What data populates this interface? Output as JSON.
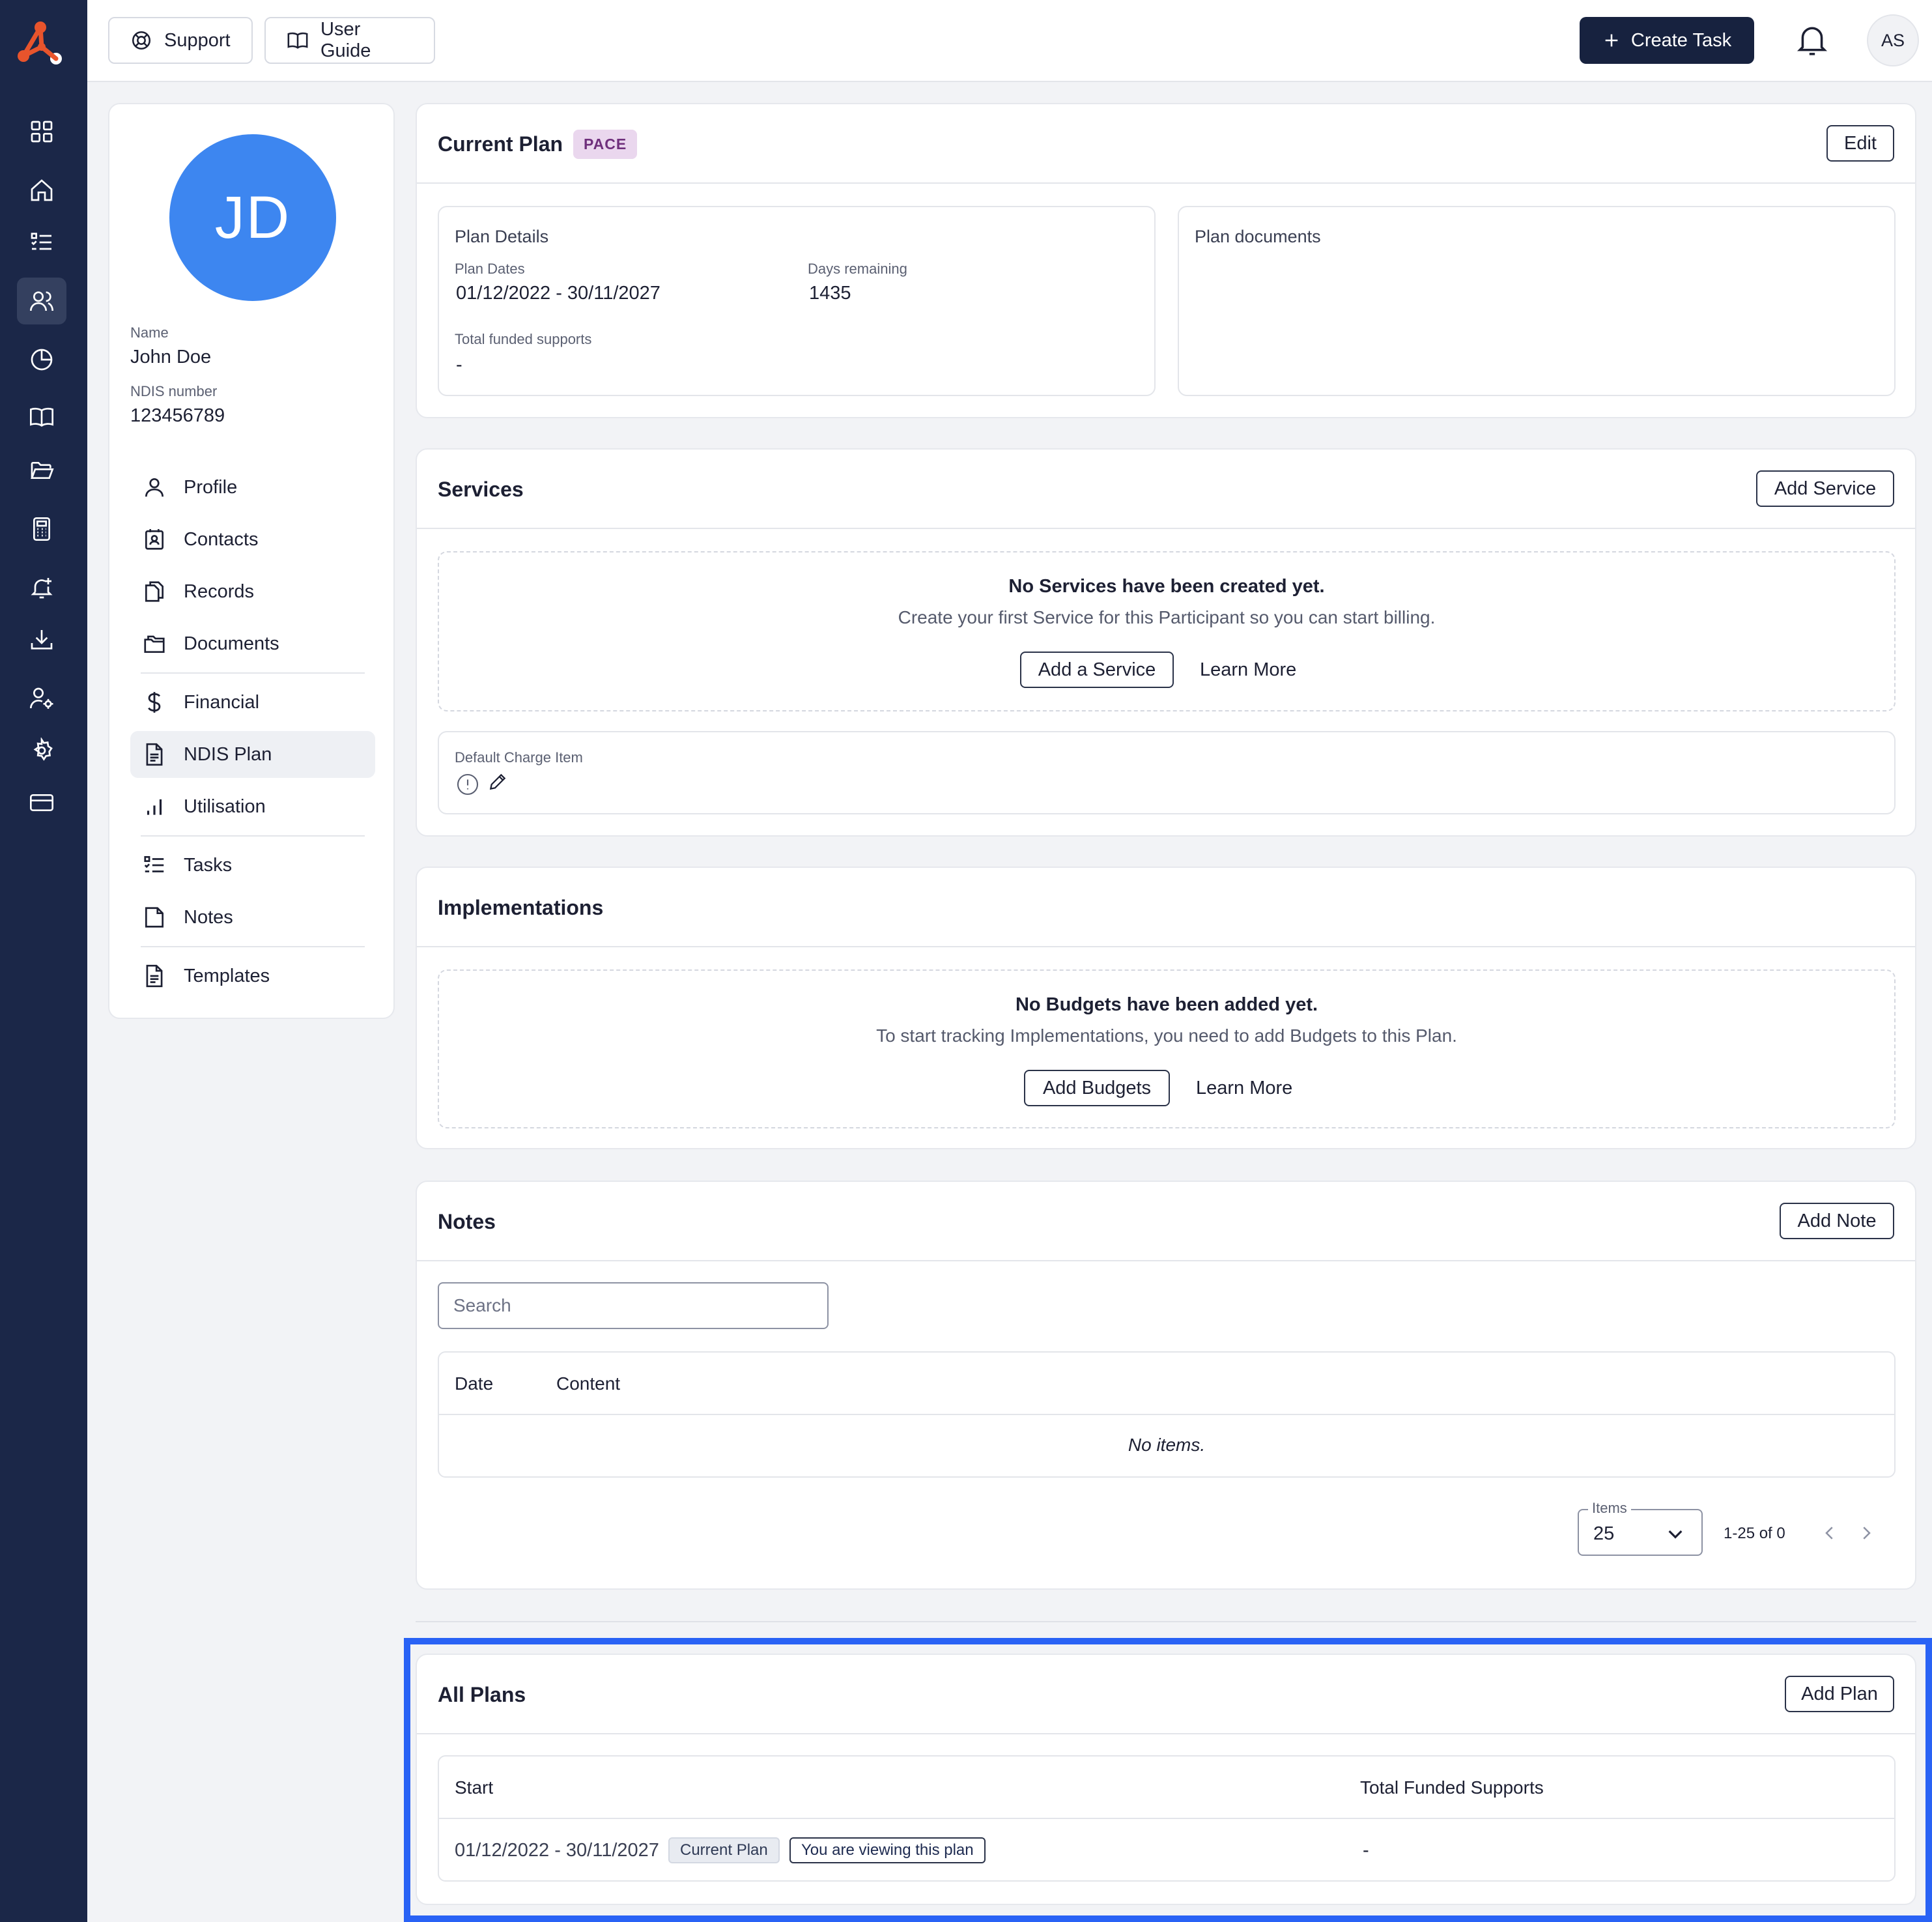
{
  "rail": {
    "icons": [
      "logo-icon",
      "dashboard-icon",
      "home-icon",
      "tasks-icon",
      "participants-icon",
      "reports-icon",
      "guide-icon",
      "folder-icon",
      "calculator-icon",
      "alerts-icon",
      "download-icon",
      "user-settings-icon",
      "settings-icon",
      "billing-icon"
    ],
    "active": "participants-icon"
  },
  "header": {
    "support_label": "Support",
    "user_guide_label": "User Guide",
    "create_task_label": "Create Task",
    "user_initials": "AS"
  },
  "participant": {
    "initials": "JD",
    "name_label": "Name",
    "name": "John Doe",
    "ndis_label": "NDIS number",
    "ndis_number": "123456789",
    "menu": [
      {
        "label": "Profile"
      },
      {
        "label": "Contacts"
      },
      {
        "label": "Records"
      },
      {
        "label": "Documents"
      },
      {
        "label": "Financial"
      },
      {
        "label": "NDIS Plan"
      },
      {
        "label": "Utilisation"
      },
      {
        "label": "Tasks"
      },
      {
        "label": "Notes"
      },
      {
        "label": "Templates"
      }
    ],
    "active_menu": "NDIS Plan"
  },
  "current_plan": {
    "title": "Current Plan",
    "badge": "PACE",
    "edit_label": "Edit",
    "details_title": "Plan Details",
    "plan_dates_label": "Plan Dates",
    "plan_dates": "01/12/2022 - 30/11/2027",
    "days_remaining_label": "Days remaining",
    "days_remaining": "1435",
    "total_funded_label": "Total funded supports",
    "total_funded": "-",
    "documents_title": "Plan documents"
  },
  "services": {
    "title": "Services",
    "add_label": "Add Service",
    "empty_title": "No Services have been created yet.",
    "empty_desc": "Create your first Service for this Participant so you can start billing.",
    "add_a_service_label": "Add a Service",
    "learn_more_label": "Learn More",
    "default_charge_label": "Default Charge Item"
  },
  "implementations": {
    "title": "Implementations",
    "empty_title": "No Budgets have been added yet.",
    "empty_desc": "To start tracking Implementations, you need to add Budgets to this Plan.",
    "add_budgets_label": "Add Budgets",
    "learn_more_label": "Learn More"
  },
  "notes": {
    "title": "Notes",
    "add_label": "Add Note",
    "search_placeholder": "Search",
    "columns": [
      "Date",
      "Content"
    ],
    "empty_text": "No items.",
    "items_label": "Items",
    "items_per_page": "25",
    "range_text": "1-25 of 0"
  },
  "all_plans": {
    "title": "All Plans",
    "add_label": "Add Plan",
    "columns": [
      "Start",
      "Total Funded Supports"
    ],
    "rows": [
      {
        "dates": "01/12/2022 - 30/11/2027",
        "badge_current": "Current Plan",
        "badge_viewing": "You are viewing this plan",
        "total": "-"
      }
    ]
  },
  "colors": {
    "rail_bg": "#1b2748",
    "primary_button": "#17223f",
    "avatar_blue": "#3d86f0",
    "logo_orange": "#e8542c",
    "pace_badge_bg": "#ead7ee",
    "highlight_border": "#2962f5"
  }
}
